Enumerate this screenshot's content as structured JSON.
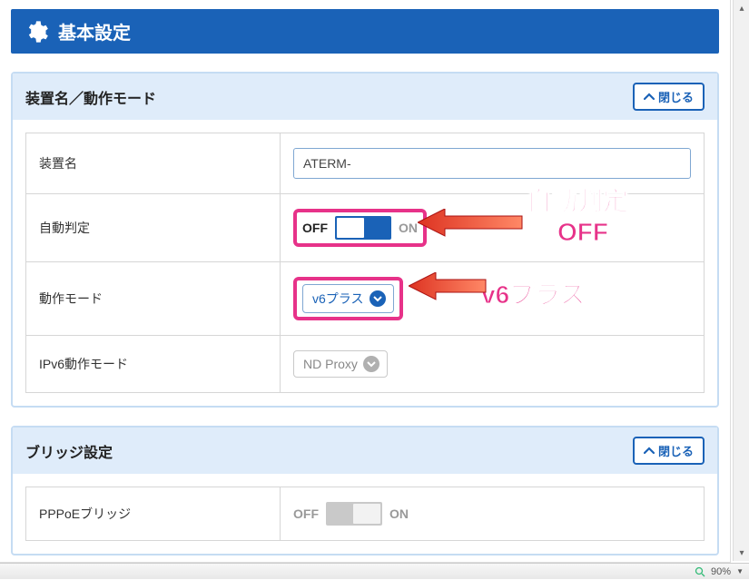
{
  "header": {
    "title": "基本設定"
  },
  "section1": {
    "title": "装置名／動作モード",
    "close_label": "閉じる",
    "rows": {
      "device_name": {
        "label": "装置名",
        "value": "ATERM-"
      },
      "auto_detect": {
        "label": "自動判定",
        "off": "OFF",
        "on": "ON"
      },
      "op_mode": {
        "label": "動作モード",
        "selected": "v6プラス"
      },
      "ipv6_mode": {
        "label": "IPv6動作モード",
        "selected": "ND Proxy"
      }
    }
  },
  "section2": {
    "title": "ブリッジ設定",
    "close_label": "閉じる",
    "rows": {
      "pppoe_bridge": {
        "label": "PPPoEブリッジ",
        "off": "OFF",
        "on": "ON"
      }
    }
  },
  "annotations": {
    "auto_off_line1": "自動判定",
    "auto_off_line2": "OFF",
    "v6plus": "v6プラス"
  },
  "statusbar": {
    "zoom": "90%"
  },
  "colors": {
    "primary": "#1a62b7",
    "accent": "#e73289"
  }
}
